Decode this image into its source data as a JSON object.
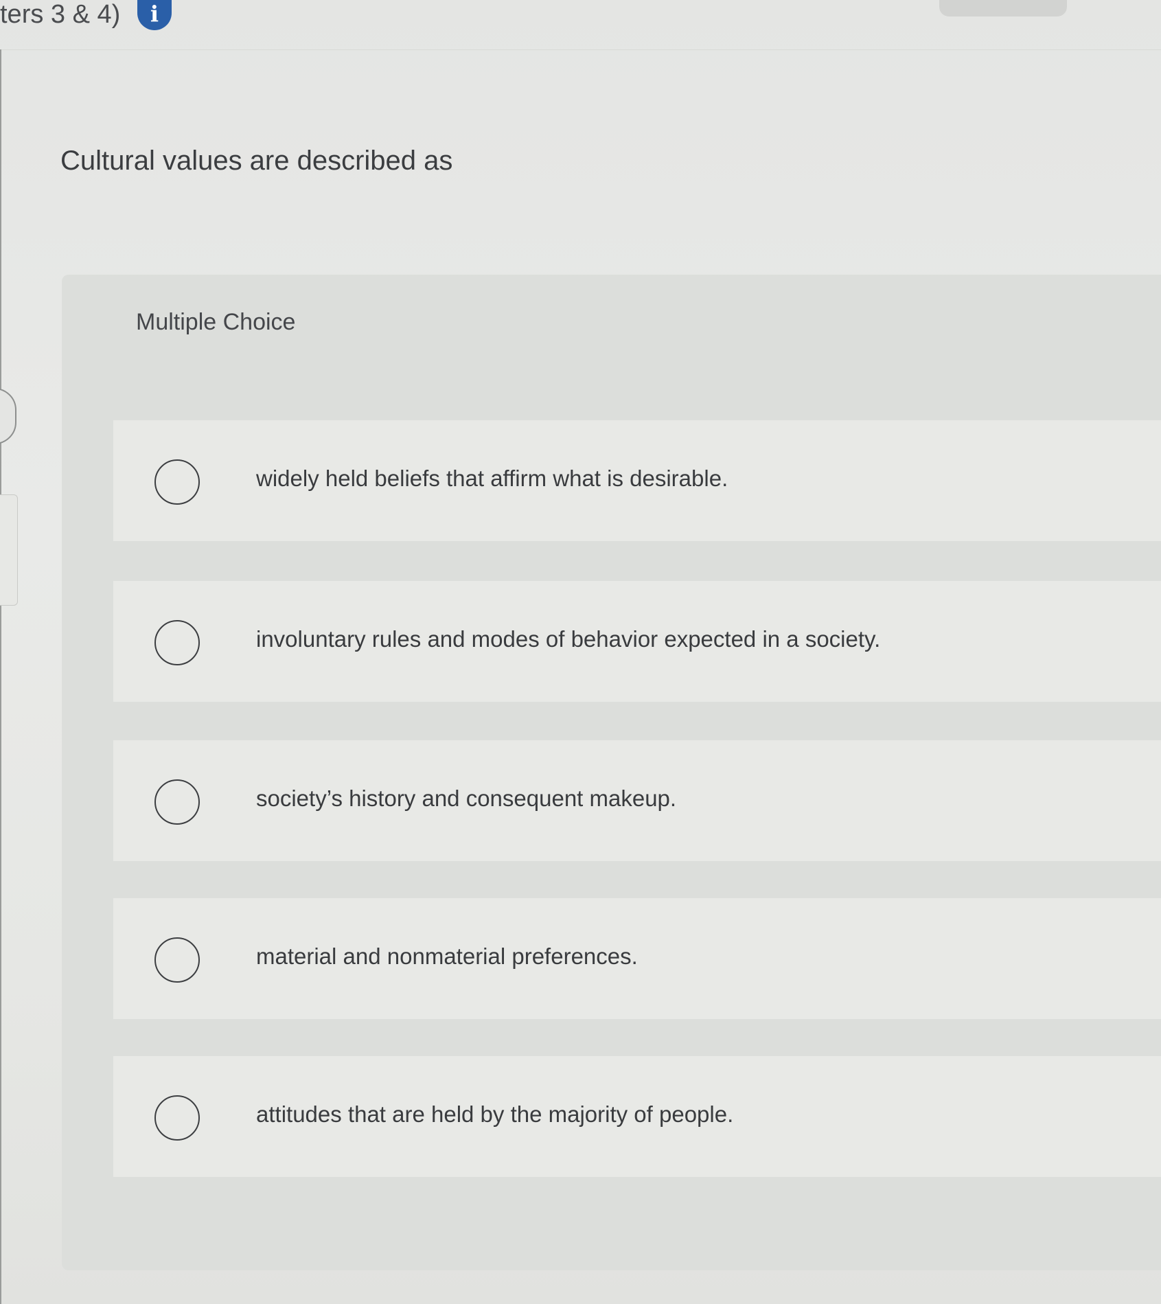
{
  "header": {
    "title_fragment": "ters 3 & 4)",
    "info_icon": "info-icon",
    "info_glyph": "i"
  },
  "question": {
    "text": "Cultural values are described as"
  },
  "choices": {
    "heading": "Multiple Choice",
    "options": [
      {
        "label": "widely held beliefs that affirm what is desirable."
      },
      {
        "label": "involuntary rules and modes of behavior expected in a society."
      },
      {
        "label": "society’s history and consequent makeup."
      },
      {
        "label": "material and nonmaterial preferences."
      },
      {
        "label": "attitudes that are held by the majority of people."
      }
    ]
  },
  "colors": {
    "accent": "#2a5fa8",
    "text": "#3b3d40",
    "panel": "#dcdedb",
    "option_background": "#e8e9e6"
  }
}
